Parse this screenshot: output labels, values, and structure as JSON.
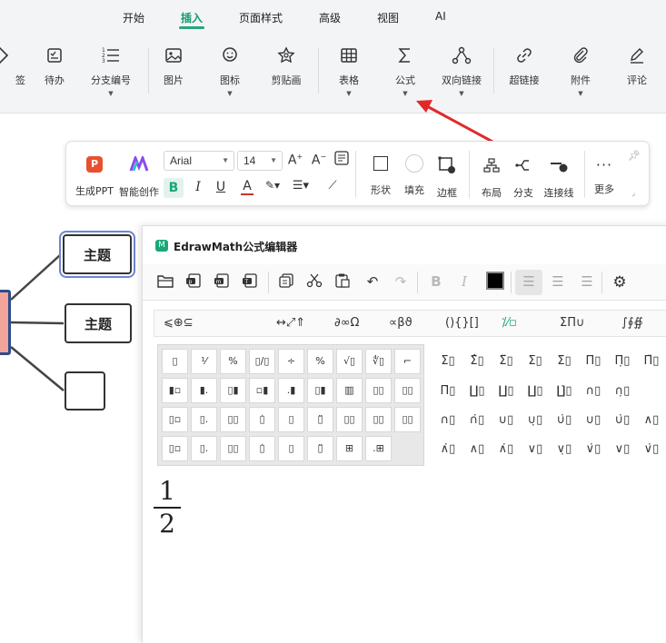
{
  "menu": {
    "tabs": [
      "开始",
      "插入",
      "页面样式",
      "高级",
      "视图",
      "AI"
    ],
    "active_tab": "插入"
  },
  "ribbon": {
    "items": [
      {
        "label": "签",
        "icon": "tag-icon"
      },
      {
        "label": "待办",
        "icon": "todo-icon"
      },
      {
        "label": "分支编号",
        "icon": "numbered-list-icon"
      },
      {
        "label": "图片",
        "icon": "image-icon"
      },
      {
        "label": "图标",
        "icon": "smiley-icon"
      },
      {
        "label": "剪贴画",
        "icon": "clipart-icon"
      },
      {
        "label": "表格",
        "icon": "table-icon"
      },
      {
        "label": "公式",
        "icon": "sigma-icon"
      },
      {
        "label": "双向链接",
        "icon": "bidirectional-link-icon"
      },
      {
        "label": "超链接",
        "icon": "hyperlink-icon"
      },
      {
        "label": "附件",
        "icon": "paperclip-icon"
      },
      {
        "label": "评论",
        "icon": "comment-pen-icon"
      }
    ]
  },
  "canvas": {
    "topics": [
      "主题",
      "主题",
      ""
    ]
  },
  "floatbar": {
    "ppt_label": "生成PPT",
    "ai_label": "智能创作",
    "font_family": "Arial",
    "font_size": "14",
    "shape_label": "形状",
    "fill_label": "填充",
    "border_label": "边框",
    "layout_label": "布局",
    "branch_label": "分支",
    "connector_label": "连接线",
    "more_label": "更多"
  },
  "editor": {
    "title": "EdrawMath公式编辑器",
    "categories": [
      "⩽⊕⊆",
      "↔⤢⇑",
      "∂∞Ω",
      "∝βϑ",
      "(){}[]",
      "⁒⁄▫",
      "ΣΠ∪",
      "∫∮∯"
    ],
    "active_category": 5,
    "formula": {
      "numerator": "1",
      "denominator": "2"
    }
  },
  "colors": {
    "accent": "#19a779",
    "arrow": "#e02a2a",
    "selected_outline": "#6f84d6",
    "root_fill": "#f2a49a"
  }
}
